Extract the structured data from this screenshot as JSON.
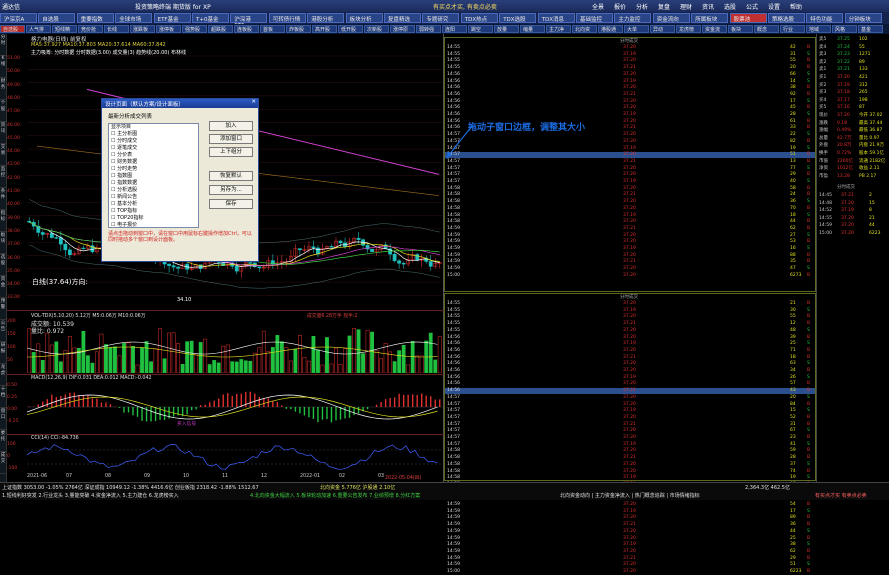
{
  "titlebar": {
    "app_name": "通达信",
    "title": "投资策略终端 期货版 for XP",
    "right": "有买点才买, 有卖点必卖",
    "menu": [
      "全景",
      "报价",
      "分析",
      "复盘",
      "理财",
      "资讯",
      "选股",
      "公式",
      "设置",
      "帮助"
    ]
  },
  "top_tabs": [
    "沪深京A",
    "自选股",
    "重要指数",
    "全球市场",
    "ETF基金",
    "T+0基金",
    "沪深港ETFs",
    "可转债行情",
    "港股分析",
    "板块分析",
    "复盘精选",
    "专题研究",
    "TDX热点",
    "TDX选股",
    "TDX消息",
    "基础监控",
    "主力监控",
    "资金流向",
    "所属板块",
    "股票池",
    "策略选股",
    "特色功能",
    "分钟板块"
  ],
  "toolbar2_tabs": [
    "自选股",
    "人气排行",
    "短线精选",
    "竞价抢筹",
    "长线",
    "涨跌板",
    "涨停板",
    "强势股",
    "超跌股",
    "连板股",
    "首板",
    "炸板股",
    "高开股",
    "低开股",
    "次新股",
    "涨停原因",
    "弱转强",
    "连阳",
    "跳空",
    "放量",
    "缩量",
    "主力净买",
    "北向资金",
    "港股通",
    "大单",
    "异动",
    "龙虎榜",
    "资金流",
    "板块",
    "概念",
    "行业",
    "地域",
    "风格",
    "基金"
  ],
  "left_strip": [
    "分时",
    "K线",
    "财务",
    "个股",
    "资讯",
    "交易",
    "监控",
    "条件",
    "指标",
    "板块",
    "选股",
    "资金",
    "预警",
    "公告",
    "研报",
    "龙虎",
    "十档",
    "盘口",
    "委托",
    "成交"
  ],
  "chart": {
    "title": "格力电器(日线)  前复权",
    "price_ticks": [
      "51.00",
      "50.00",
      "49.00",
      "48.00",
      "47.00",
      "46.00",
      "45.00",
      "44.00",
      "43.00",
      "42.00",
      "41.00",
      "40.00",
      "39.00",
      "38.00",
      "37.00",
      "36.00",
      "35.00",
      "34.00",
      "33.00"
    ],
    "ma_line": "MA5:37.927  MA10:37.803  MA20:37.614  MA60:37.842",
    "info_line": "主力吸筹: 分时数据  分时数据(3.00)  成交量(3)  趋势线(20.00)  布林线",
    "low_label": "34.10",
    "white_line": "白线(37.64)方向:",
    "vol_label": "VOL-TDX(5,10,20) 5.12万  M5:0.06万  M10:0.06万",
    "vol_sub1": "成交额: 10.539",
    "vol_sub2": "量比: 0.972",
    "macd_label": "MACD(12,26,9) DIF:0.031 DEA:0.012 MACD:-0.042",
    "macd_signal": "买入信号",
    "cci_label": "CCI(14) CCI:-84.736",
    "axis_dates": [
      "2021-06",
      "07",
      "08",
      "09",
      "10",
      "11",
      "12",
      "2022-01",
      "02",
      "03"
    ],
    "xlast": "2022-05-04(四)",
    "vol_right": "成交量6.28万手  现手:2",
    "vol_ticks": [
      "200",
      "150",
      "100",
      "50"
    ],
    "macd_ticks": [
      "0.50",
      "0.25",
      "0.00",
      "-0.25"
    ],
    "cci_ticks": [
      "100",
      "0",
      "-100"
    ]
  },
  "dialog": {
    "title": "设计页面（默认方案/设计面板）",
    "label": "最新分析成交列表",
    "items": [
      "显示项目",
      "主分析图",
      "分时成交",
      "逐笔成交",
      "分价表",
      "财务数据",
      "分时走势",
      "指数图",
      "指数数据",
      "分析选股",
      "新闻公告",
      "基本分析",
      "TOP指标",
      "TOP20指标",
      "电子报价",
      "公告",
      "宏观数据",
      "十大股东",
      "主营构成"
    ],
    "btn_add": "加入",
    "btn_edit": "添加窗口",
    "btn_up": "上下组分",
    "btn_default": "恢复默认",
    "btn_save_as": "另存为...",
    "btn_ok": "保存",
    "note": "请点击拖动到窗口中，请在窗口中用鼠标右键操作增加Ctrl，可以同时拖动多个窗口到设计面板。"
  },
  "annotation": "拖动子窗口边框，调整其大小",
  "tick_panel1": {
    "header": "分时成交",
    "rows": [
      [
        "14:55",
        "37.20",
        "42",
        "B"
      ],
      [
        "14:55",
        "37.19",
        "31",
        "S"
      ],
      [
        "14:55",
        "37.20",
        "55",
        "B"
      ],
      [
        "14:55",
        "37.21",
        "20",
        "B"
      ],
      [
        "14:56",
        "37.20",
        "66",
        "S"
      ],
      [
        "14:56",
        "37.19",
        "14",
        "S"
      ],
      [
        "14:56",
        "37.20",
        "38",
        "B"
      ],
      [
        "14:56",
        "37.21",
        "92",
        "B"
      ],
      [
        "14:56",
        "37.20",
        "17",
        "S"
      ],
      [
        "14:56",
        "37.20",
        "45",
        "B"
      ],
      [
        "14:56",
        "37.19",
        "28",
        "S"
      ],
      [
        "14:56",
        "37.20",
        "61",
        "B"
      ],
      [
        "14:56",
        "37.21",
        "33",
        "B"
      ],
      [
        "14:57",
        "37.20",
        "22",
        "S"
      ],
      [
        "14:57",
        "37.20",
        "82",
        "B"
      ],
      [
        "14:57",
        "37.19",
        "19",
        "S"
      ],
      [
        "14:57",
        "37.20",
        "51",
        "B"
      ],
      [
        "14:57",
        "37.21",
        "13",
        "B"
      ],
      [
        "14:57",
        "37.20",
        "77",
        "S"
      ],
      [
        "14:57",
        "37.20",
        "29",
        "B"
      ],
      [
        "14:57",
        "37.19",
        "40",
        "S"
      ],
      [
        "14:58",
        "37.20",
        "58",
        "B"
      ],
      [
        "14:58",
        "37.21",
        "24",
        "B"
      ],
      [
        "14:58",
        "37.20",
        "36",
        "S"
      ],
      [
        "14:58",
        "37.20",
        "70",
        "B"
      ],
      [
        "14:58",
        "37.19",
        "18",
        "S"
      ],
      [
        "14:58",
        "37.20",
        "44",
        "B"
      ],
      [
        "14:59",
        "37.21",
        "62",
        "B"
      ],
      [
        "14:59",
        "37.20",
        "27",
        "S"
      ],
      [
        "14:59",
        "37.20",
        "53",
        "B"
      ],
      [
        "14:59",
        "37.19",
        "16",
        "S"
      ],
      [
        "14:59",
        "37.20",
        "88",
        "B"
      ],
      [
        "14:59",
        "37.21",
        "35",
        "B"
      ],
      [
        "14:59",
        "37.20",
        "47",
        "S"
      ],
      [
        "15:00",
        "37.20",
        "6273",
        "B"
      ]
    ]
  },
  "tick_panel2": {
    "header": "分时成交",
    "rows": [
      [
        "14:55",
        "37.20",
        "21",
        "B"
      ],
      [
        "14:55",
        "37.19",
        "30",
        "S"
      ],
      [
        "14:55",
        "37.20",
        "55",
        "B"
      ],
      [
        "14:55",
        "37.21",
        "12",
        "B"
      ],
      [
        "14:55",
        "37.20",
        "48",
        "S"
      ],
      [
        "14:56",
        "37.20",
        "39",
        "B"
      ],
      [
        "14:56",
        "37.19",
        "25",
        "S"
      ],
      [
        "14:56",
        "37.20",
        "71",
        "B"
      ],
      [
        "14:56",
        "37.21",
        "18",
        "B"
      ],
      [
        "14:56",
        "37.20",
        "63",
        "S"
      ],
      [
        "14:56",
        "37.20",
        "34",
        "B"
      ],
      [
        "14:56",
        "37.19",
        "26",
        "S"
      ],
      [
        "14:56",
        "37.20",
        "57",
        "B"
      ],
      [
        "14:56",
        "37.21",
        "43",
        "B"
      ],
      [
        "14:57",
        "37.20",
        "20",
        "S"
      ],
      [
        "14:57",
        "37.20",
        "84",
        "B"
      ],
      [
        "14:57",
        "37.19",
        "15",
        "S"
      ],
      [
        "14:57",
        "37.20",
        "52",
        "B"
      ],
      [
        "14:57",
        "37.21",
        "31",
        "B"
      ],
      [
        "14:57",
        "37.20",
        "67",
        "S"
      ],
      [
        "14:57",
        "37.20",
        "23",
        "B"
      ],
      [
        "14:57",
        "37.19",
        "41",
        "S"
      ],
      [
        "14:58",
        "37.20",
        "59",
        "B"
      ],
      [
        "14:58",
        "37.21",
        "28",
        "B"
      ],
      [
        "14:58",
        "37.20",
        "37",
        "S"
      ],
      [
        "14:58",
        "37.20",
        "74",
        "B"
      ],
      [
        "14:58",
        "37.19",
        "19",
        "S"
      ],
      [
        "14:58",
        "37.20",
        "46",
        "B"
      ],
      [
        "14:59",
        "37.21",
        "61",
        "B"
      ],
      [
        "14:59",
        "37.20",
        "32",
        "S"
      ],
      [
        "14:59",
        "37.20",
        "54",
        "B"
      ],
      [
        "14:59",
        "37.19",
        "17",
        "S"
      ],
      [
        "14:59",
        "37.20",
        "89",
        "B"
      ],
      [
        "14:59",
        "37.21",
        "36",
        "B"
      ],
      [
        "14:59",
        "37.20",
        "44",
        "S"
      ],
      [
        "14:59",
        "37.20",
        "25",
        "B"
      ],
      [
        "14:59",
        "37.19",
        "38",
        "S"
      ],
      [
        "14:59",
        "37.20",
        "62",
        "B"
      ],
      [
        "14:59",
        "37.21",
        "29",
        "B"
      ],
      [
        "14:59",
        "37.20",
        "51",
        "S"
      ],
      [
        "15:00",
        "37.20",
        "6223",
        "B"
      ]
    ]
  },
  "quote": {
    "rows": [
      [
        "卖5",
        "37.25",
        "102"
      ],
      [
        "卖4",
        "37.24",
        "55"
      ],
      [
        "卖3",
        "37.23",
        "1271"
      ],
      [
        "卖2",
        "37.22",
        "89"
      ],
      [
        "卖1",
        "37.21",
        "133"
      ],
      [
        "买1",
        "37.20",
        "421"
      ],
      [
        "买2",
        "37.19",
        "312"
      ],
      [
        "买3",
        "37.18",
        "265"
      ],
      [
        "买4",
        "37.17",
        "198"
      ],
      [
        "买5",
        "37.16",
        "87"
      ],
      [
        "现价",
        "37.20",
        "今开 37.02"
      ],
      [
        "涨跌",
        "0.18",
        "最高 37.44"
      ],
      [
        "涨幅",
        "0.49%",
        "最低 36.87"
      ],
      [
        "总量",
        "42.7万",
        "量比 0.97"
      ],
      [
        "外盘",
        "20.8万",
        "内盘 21.9万"
      ],
      [
        "换手",
        "0.72%",
        "股本 59.1亿"
      ],
      [
        "市值",
        "2200亿",
        "流通 2182亿"
      ],
      [
        "净资",
        "1012亿",
        "收益 2.11"
      ],
      [
        "市盈",
        "13.28",
        "PB 2.17"
      ]
    ],
    "sub_header": "分时成交",
    "sub_rows": [
      [
        "14:45",
        "37.21",
        "2"
      ],
      [
        "14:48",
        "37.20",
        "15"
      ],
      [
        "14:52",
        "37.19",
        "8"
      ],
      [
        "14:55",
        "37.20",
        "21"
      ],
      [
        "14:59",
        "37.20",
        "44"
      ],
      [
        "15:00",
        "37.20",
        "6223"
      ]
    ]
  },
  "bottom": {
    "indices": "上证指数  3053.00  -1.05%  2764亿   深证成指  10949.12  -1.38%  4416.6亿   创业板指  2318.42  -1.88%   1512.67",
    "cash": "北向资金  5.776亿   沪股通  2.10亿",
    "right": "2,364.3亿   462.5亿",
    "ticker1": "1.短线利好突发 2.行业龙头 3.量能突破  4.资金净流入 5.主力建仓 6.龙虎榜买入",
    "ticker2": "4.北向资金大幅流入 5.板块轮动加速 6.重要公告发布 7.业绩预增 8.分红方案",
    "ticker3": "北向资金动向 | 主力资金净流入 | 热门概念追踪 | 市场情绪指标",
    "red_label": "有买点才买 有卖点必卖"
  },
  "colors": {
    "accent": "#c03030",
    "tab_bg": "#2a4488",
    "annot": "#1a6ae0",
    "up": "#e03030",
    "down": "#20c040",
    "ma_white": "#ffffff",
    "ma_yellow": "#e0e020",
    "ma_magenta": "#d040d0",
    "ma_green": "#40d040",
    "highlight": "#2b4f8f"
  }
}
